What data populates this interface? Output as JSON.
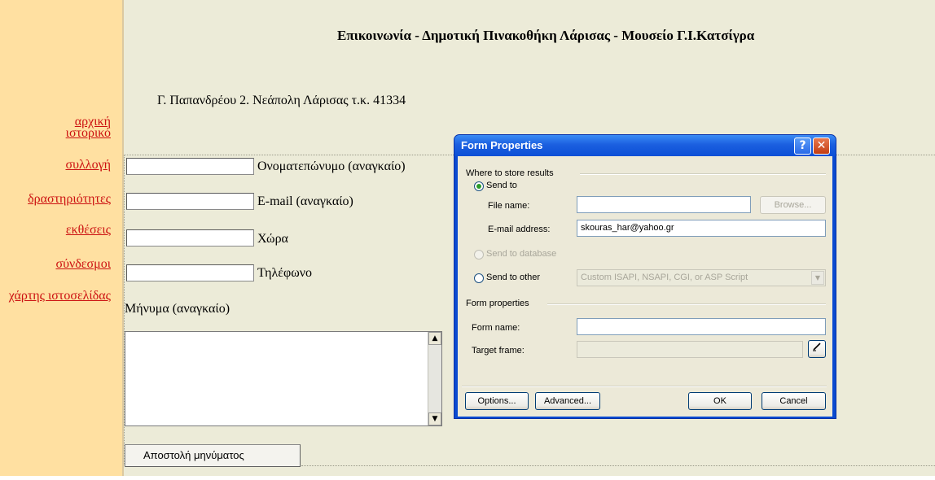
{
  "sidebar": {
    "links": [
      {
        "label": "αρχική"
      },
      {
        "label": "ιστορικό"
      },
      {
        "label": "συλλογή"
      },
      {
        "label": "δραστηριότητες"
      },
      {
        "label": "εκθέσεις"
      },
      {
        "label": "σύνδεσμοι"
      },
      {
        "label": "χάρτης ιστοσελίδας"
      }
    ]
  },
  "page": {
    "title": "Επικοινωνία - Δημοτική Πινακοθήκη Λάρισας - Μουσείο Γ.Ι.Κατσίγρα",
    "address": "Γ. Παπανδρέου 2.  Νεάπολη Λάρισας τ.κ. 41334"
  },
  "form": {
    "fields": [
      {
        "label": "Ονοματεπώνυμο (αναγκαίο)",
        "value": ""
      },
      {
        "label": "E-mail (αναγκαίο)",
        "value": ""
      },
      {
        "label": "Χώρα",
        "value": ""
      },
      {
        "label": "Τηλέφωνο",
        "value": ""
      }
    ],
    "message_label": "Μήνυμα (αναγκαίο)",
    "message_value": "",
    "submit_label": "Αποστολή μηνύματος"
  },
  "dialog": {
    "title": "Form Properties",
    "help_glyph": "?",
    "close_glyph": "✕",
    "store_group_label": "Where to store results",
    "send_to_label": "Send to",
    "file_name_label": "File name:",
    "file_name_value": "",
    "browse_label": "Browse...",
    "email_label": "E-mail address:",
    "email_value": "skouras_har@yahoo.gr",
    "send_db_label": "Send to database",
    "send_other_label": "Send to other",
    "send_other_option": "Custom ISAPI, NSAPI, CGI, or ASP Script",
    "form_props_group_label": "Form properties",
    "form_name_label": "Form name:",
    "form_name_value": "",
    "target_frame_label": "Target frame:",
    "target_frame_value": "",
    "options_label": "Options...",
    "advanced_label": "Advanced...",
    "ok_label": "OK",
    "cancel_label": "Cancel",
    "selected_destination": "Send to"
  },
  "colors": {
    "sidebar_bg": "#ffe0a1",
    "main_bg": "#ecebd8",
    "link": "#cc1111",
    "dialog_titlebar": "#0b4fd6"
  }
}
